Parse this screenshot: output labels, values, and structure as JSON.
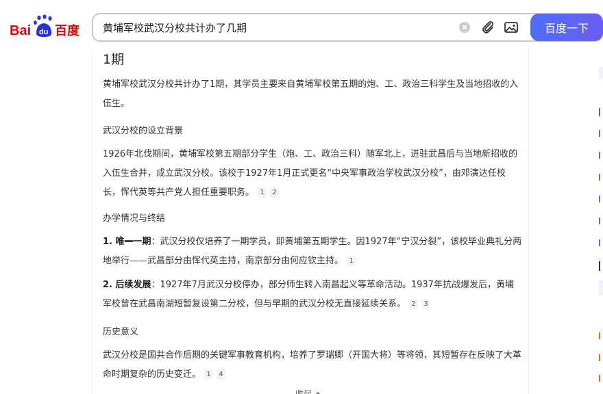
{
  "header": {
    "search_query": "黄埔军校武汉分校共计办了几期",
    "submit_label": "百度一下",
    "logo_text_left": "Bai",
    "logo_text_du": "du",
    "logo_text_right": "百度"
  },
  "answer": {
    "title": "1期",
    "summary": "黄埔军校武汉分校共计办了1期，其学员主要来自黄埔军校第五期的炮、工、政治三科学生及当地招收的入伍生。",
    "sections": [
      {
        "heading": "武汉分校的设立背景",
        "body": "1926年北伐期间，黄埔军校第五期部分学生（炮、工、政治三科）随军北上，进驻武昌后与当地新招收的入伍生合并，成立武汉分校。该校于1927年1月正式更名“中央军事政治学校武汉分校”，由邓演达任校长，恽代英等共产党人担任重要职务。",
        "cites": [
          "1",
          "2"
        ]
      },
      {
        "heading": "办学情况与终结",
        "items": [
          {
            "label_prefix": "1. 唯",
            "label_struck": "一",
            "label_suffix": "一期",
            "text": "：武汉分校仅培养了一期学员，即黄埔第五期学生。因1927年“宁汉分裂”，该校毕业典礼分两地举行——武昌部分由恽代英主持，南京部分由何应钦主持。",
            "cites": [
              "1"
            ]
          },
          {
            "label": "2. 后续发展",
            "text": "：1927年7月武汉分校停办，部分师生转入南昌起义等革命活动。1937年抗战爆发后，黄埔军校曾在武昌南湖短暂复设第二分校，但与早期的武汉分校无直接延续关系。",
            "cites": [
              "2",
              "3"
            ]
          }
        ]
      },
      {
        "heading": "历史意义",
        "body": "武汉分校是国共合作后期的关键军事教育机构，培养了罗瑞卿（开国大将）等将领，其短暂存在反映了大革命时期复杂的历史变迁。",
        "cites": [
          "1",
          "4"
        ]
      }
    ],
    "collapse_label": "收起"
  },
  "colors": {
    "brand_blue": "#2932e1",
    "brand_red": "#e10602",
    "submit_gradient_start": "#4e6ef2",
    "submit_gradient_end": "#6a5df5"
  },
  "icons": [
    "clear-icon",
    "attachment-icon",
    "image-search-icon",
    "chevron-up-icon"
  ]
}
